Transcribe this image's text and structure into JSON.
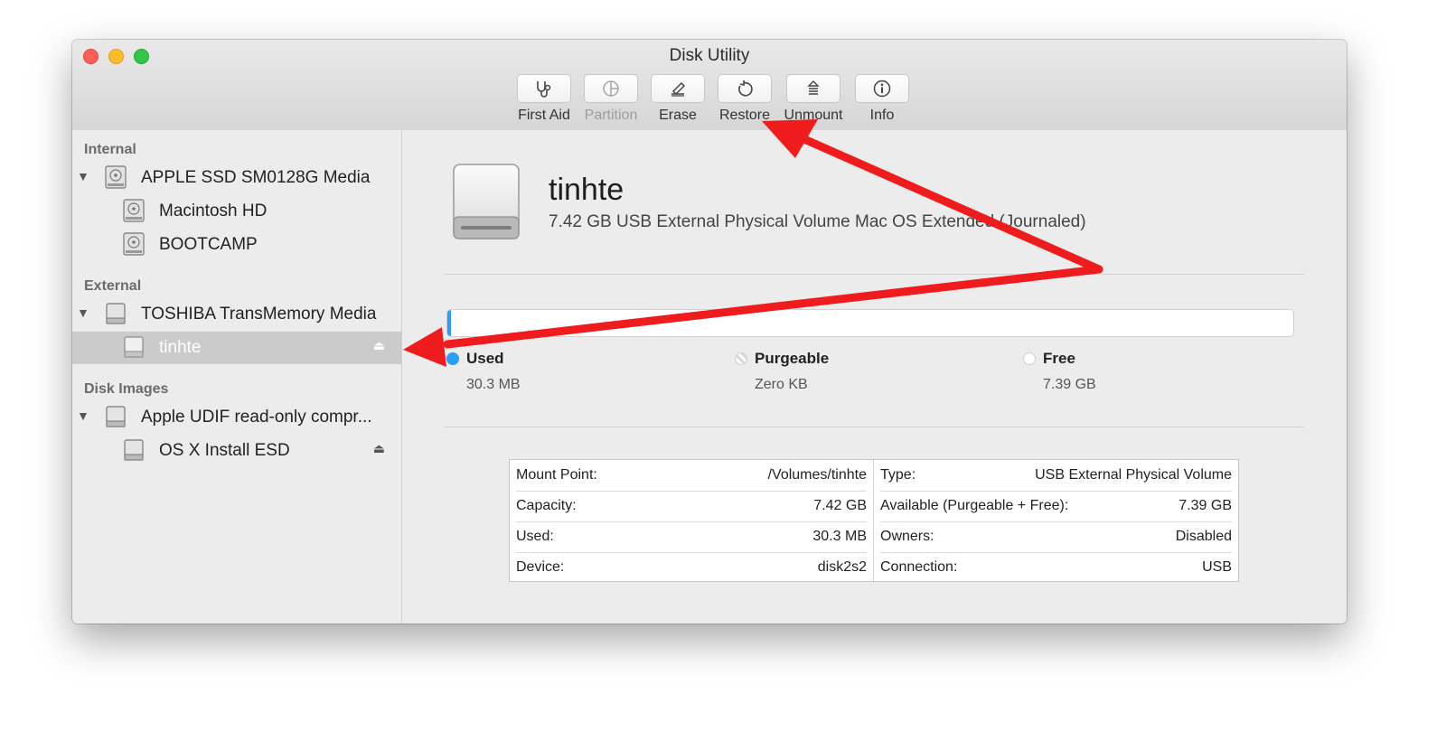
{
  "window": {
    "title": "Disk Utility"
  },
  "toolbar": [
    {
      "label": "First Aid",
      "icon": "stethoscope-icon",
      "enabled": true
    },
    {
      "label": "Partition",
      "icon": "partition-icon",
      "enabled": false
    },
    {
      "label": "Erase",
      "icon": "erase-icon",
      "enabled": true
    },
    {
      "label": "Restore",
      "icon": "restore-icon",
      "enabled": true
    },
    {
      "label": "Unmount",
      "icon": "unmount-icon",
      "enabled": true
    },
    {
      "label": "Info",
      "icon": "info-icon",
      "enabled": true
    }
  ],
  "sidebar": {
    "internal": {
      "heading": "Internal",
      "disk": "APPLE SSD SM0128G Media",
      "volumes": [
        "Macintosh HD",
        "BOOTCAMP"
      ]
    },
    "external": {
      "heading": "External",
      "disk": "TOSHIBA TransMemory Media",
      "volumes": [
        "tinhte"
      ]
    },
    "disk_images": {
      "heading": "Disk Images",
      "disk": "Apple UDIF read-only compr...",
      "volumes": [
        "OS X Install ESD"
      ]
    },
    "selected": "tinhte"
  },
  "volume": {
    "name": "tinhte",
    "description": "7.42 GB USB External Physical Volume Mac OS Extended (Journaled)"
  },
  "usage": {
    "used_fraction": 0.004,
    "colors": {
      "used": "#2a9df4",
      "free": "#ffffff"
    },
    "legend": [
      {
        "label": "Used",
        "value": "30.3 MB"
      },
      {
        "label": "Purgeable",
        "value": "Zero KB"
      },
      {
        "label": "Free",
        "value": "7.39 GB"
      }
    ]
  },
  "info": {
    "left": [
      {
        "key": "Mount Point:",
        "value": "/Volumes/tinhte"
      },
      {
        "key": "Capacity:",
        "value": "7.42 GB"
      },
      {
        "key": "Used:",
        "value": "30.3 MB"
      },
      {
        "key": "Device:",
        "value": "disk2s2"
      }
    ],
    "right": [
      {
        "key": "Type:",
        "value": "USB External Physical Volume"
      },
      {
        "key": "Available (Purgeable + Free):",
        "value": "7.39 GB"
      },
      {
        "key": "Owners:",
        "value": "Disabled"
      },
      {
        "key": "Connection:",
        "value": "USB"
      }
    ]
  },
  "annotation_color": "#ee1c1c"
}
